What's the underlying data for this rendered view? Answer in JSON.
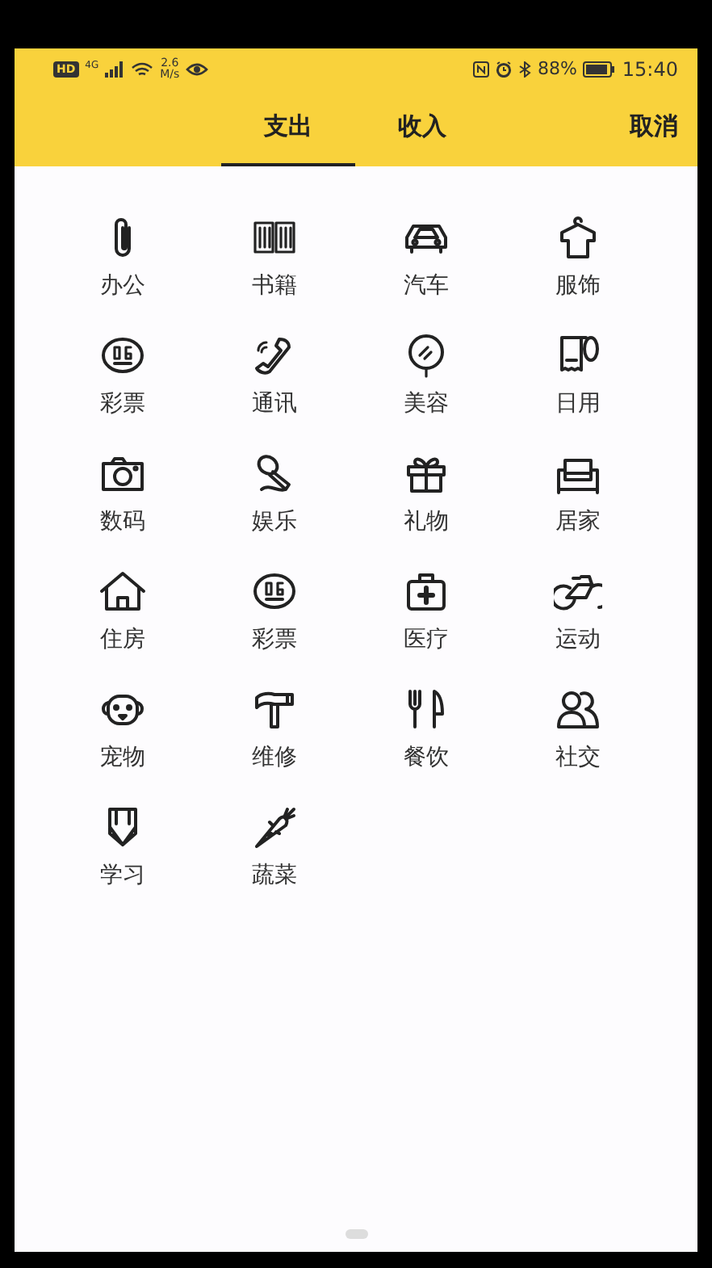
{
  "status_bar": {
    "network_badge": "HD",
    "network_type": "4G",
    "speed_value": "2.6",
    "speed_unit": "M/s",
    "battery": "88%",
    "time": "15:40"
  },
  "tabs": [
    {
      "label": "支出",
      "selected": true
    },
    {
      "label": "收入",
      "selected": false
    }
  ],
  "cancel": "取消",
  "categories": [
    {
      "label": "办公"
    },
    {
      "label": "书籍"
    },
    {
      "label": "汽车"
    },
    {
      "label": "服饰"
    },
    {
      "label": "彩票"
    },
    {
      "label": "通讯"
    },
    {
      "label": "美容"
    },
    {
      "label": "日用"
    },
    {
      "label": "数码"
    },
    {
      "label": "娱乐"
    },
    {
      "label": "礼物"
    },
    {
      "label": "居家"
    },
    {
      "label": "住房"
    },
    {
      "label": "彩票"
    },
    {
      "label": "医疗"
    },
    {
      "label": "运动"
    },
    {
      "label": "宠物"
    },
    {
      "label": "维修"
    },
    {
      "label": "餐饮"
    },
    {
      "label": "社交"
    },
    {
      "label": "学习"
    },
    {
      "label": "蔬菜"
    }
  ]
}
